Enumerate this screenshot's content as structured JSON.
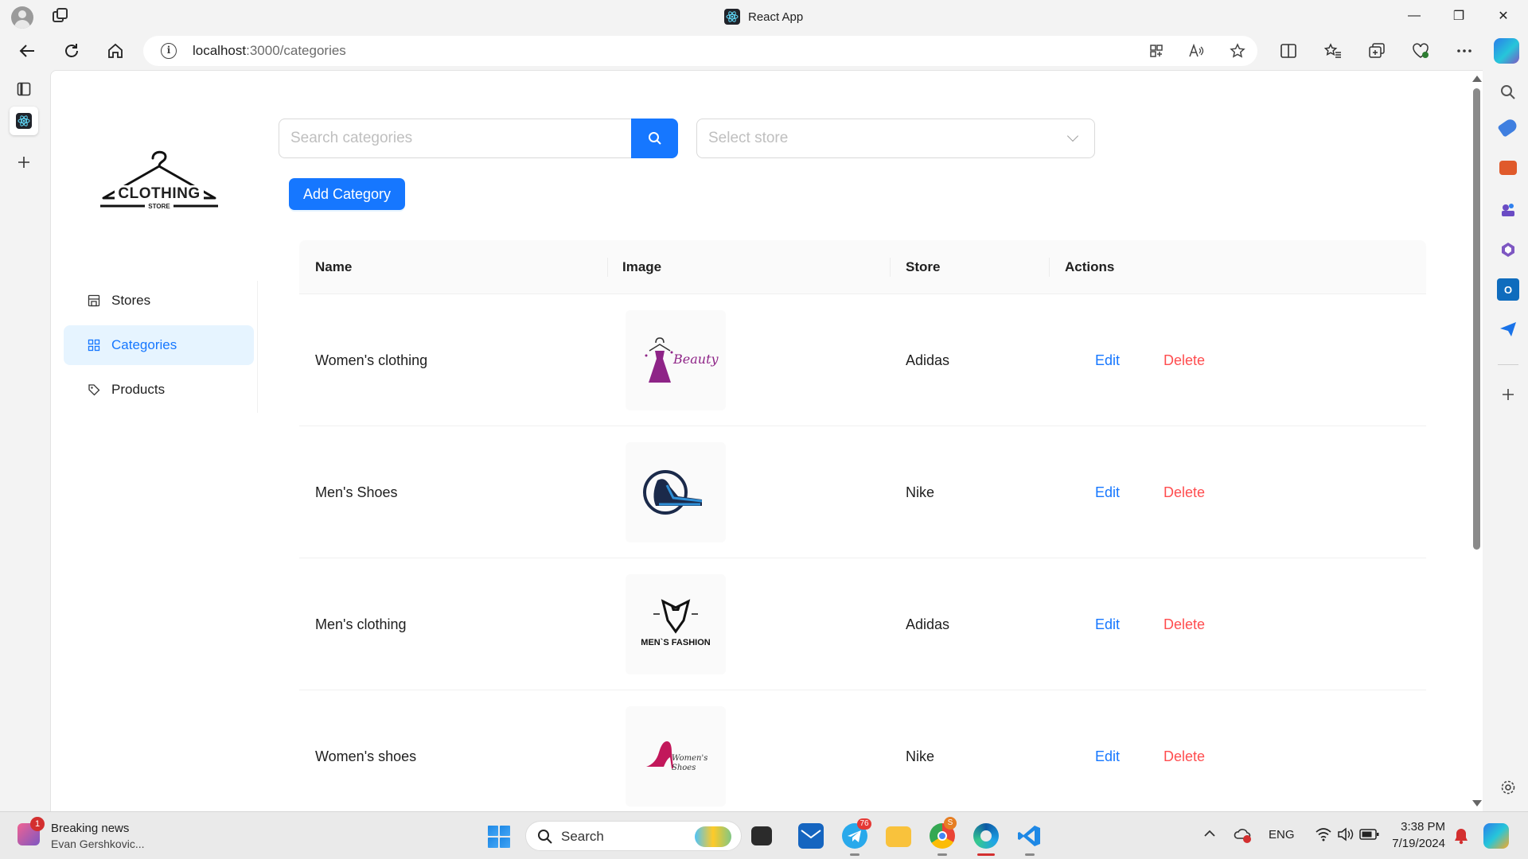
{
  "window": {
    "tab_title": "React App",
    "minimize": "—",
    "restore": "❐",
    "close": "✕"
  },
  "address_bar": {
    "host": "localhost",
    "path": ":3000/categories"
  },
  "app": {
    "logo": {
      "brand": "CLOTHING",
      "tagline": "STORE"
    },
    "nav": [
      {
        "label": "Stores",
        "icon": "shop-icon"
      },
      {
        "label": "Categories",
        "icon": "appstore-icon"
      },
      {
        "label": "Products",
        "icon": "tag-icon"
      }
    ],
    "search": {
      "placeholder": "Search categories"
    },
    "store_filter": {
      "placeholder": "Select store"
    },
    "add_button": "Add Category",
    "table": {
      "columns": [
        "Name",
        "Image",
        "Store",
        "Actions"
      ],
      "rows": [
        {
          "name": "Women's clothing",
          "image": "beauty-fashion-logo",
          "image_text": "Beauty",
          "store": "Adidas",
          "edit": "Edit",
          "delete": "Delete"
        },
        {
          "name": "Men's Shoes",
          "image": "sneaker-logo",
          "image_text": "",
          "store": "Nike",
          "edit": "Edit",
          "delete": "Delete"
        },
        {
          "name": "Men's clothing",
          "image": "mens-fashion-logo",
          "image_text": "MEN`S FASHION",
          "store": "Adidas",
          "edit": "Edit",
          "delete": "Delete"
        },
        {
          "name": "Women's shoes",
          "image": "womens-shoes-logo",
          "image_text": "Women's Shoes",
          "store": "Nike",
          "edit": "Edit",
          "delete": "Delete"
        }
      ]
    }
  },
  "taskbar": {
    "news_title": "Breaking news",
    "news_subtitle": "Evan Gershkovic...",
    "news_badge": "1",
    "search_label": "Search",
    "telegram_badge": "76",
    "chrome_badge": "S",
    "language": "ENG",
    "time": "3:38 PM",
    "date": "7/19/2024"
  },
  "colors": {
    "primary": "#1677ff",
    "danger": "#ff4d4f",
    "selected_bg": "#e6f4ff"
  }
}
